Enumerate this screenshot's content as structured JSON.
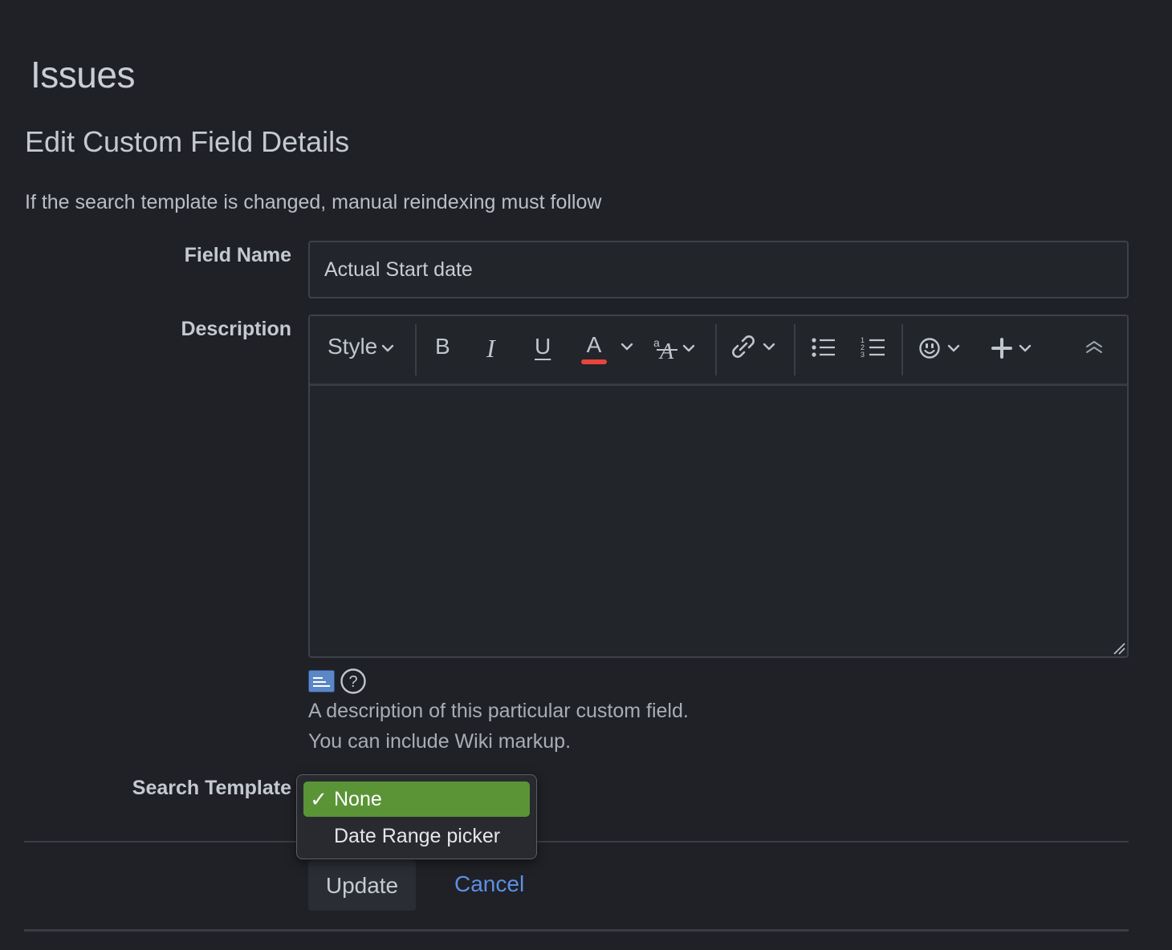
{
  "page": {
    "title": "Issues",
    "subtitle": "Edit Custom Field Details",
    "intro": "If the search template is changed, manual reindexing must follow"
  },
  "form": {
    "field_name_label": "Field Name",
    "field_name_value": "Actual Start date",
    "description_label": "Description",
    "description_help_line1": "A description of this particular custom field.",
    "description_help_line2": "You can include Wiki markup.",
    "search_template_label": "Search Template"
  },
  "editor": {
    "toolbar": {
      "style": "Style",
      "bold": "B",
      "italic": "I",
      "underline": "U",
      "text_color": "A"
    },
    "text_color_underline": "#e8453c",
    "value": ""
  },
  "search_template": {
    "options": [
      "None",
      "Date Range picker"
    ],
    "selected": "None",
    "selected_mark": "✓",
    "highlight_color": "#5a9437"
  },
  "actions": {
    "update": "Update",
    "cancel": "Cancel"
  }
}
